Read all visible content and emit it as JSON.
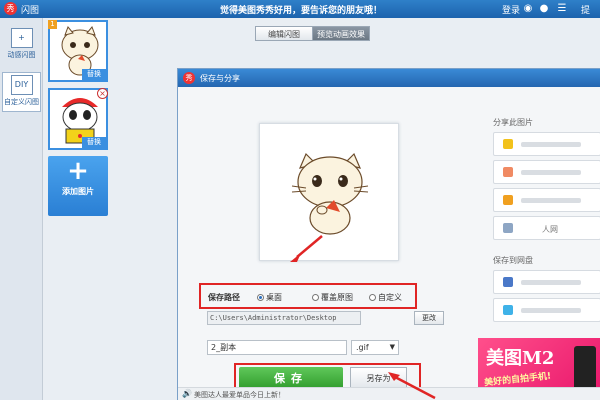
{
  "window": {
    "app_logo": "秀",
    "title": "闪图",
    "promo": "觉得美图秀秀好用，要告诉您的朋友哦！",
    "login": "登录",
    "tip": "提"
  },
  "toolstrip": {
    "items": [
      {
        "icon": "+",
        "label": "动感闪图"
      },
      {
        "icon": "DIY",
        "label": "自定义闪图"
      }
    ]
  },
  "frames": {
    "items": [
      {
        "num": "1",
        "replace": "替换"
      },
      {
        "close": "×",
        "replace": "替换"
      }
    ],
    "add": {
      "plus": "+",
      "label": "添加图片"
    }
  },
  "tabs": [
    {
      "label": "编辑闪图"
    },
    {
      "label": "预览动画效果"
    }
  ],
  "dialog": {
    "logo": "秀",
    "title": "保存与分享",
    "save_path_label": "保存路径",
    "radios": [
      {
        "label": "桌面",
        "checked": true
      },
      {
        "label": "覆盖原图",
        "checked": false
      },
      {
        "label": "自定义",
        "checked": false
      }
    ],
    "path_value": "C:\\Users\\Administrator\\Desktop",
    "change_label": "更改",
    "filename": "2_副本",
    "format": ".gif",
    "save_label": "保存",
    "save_as_label": "另存为",
    "share_title": "分享此图片",
    "cloud_title": "保存到网盘",
    "share_items": [
      {
        "icon": "star-icon",
        "color": "#f2c21b",
        "label": ""
      },
      {
        "icon": "square-icon",
        "color": "#f08a63",
        "label": ""
      },
      {
        "icon": "chat-icon",
        "color": "#f0a020",
        "label": ""
      },
      {
        "icon": "grid-icon",
        "color": "#8ea6c4",
        "label": "人网"
      },
      {
        "icon": "link-icon",
        "color": "#4a78c8",
        "label": ""
      },
      {
        "icon": "bird-icon",
        "color": "#3fb2e8",
        "label": ""
      }
    ],
    "ad": {
      "big": "美图M2",
      "small": "美好的自拍手机!"
    },
    "news": "美图达人最爱单品今日上新！",
    "colors": {
      "accent": "#2a6fc0",
      "highlight": "#e02525",
      "save_green": "#3aa336"
    }
  }
}
